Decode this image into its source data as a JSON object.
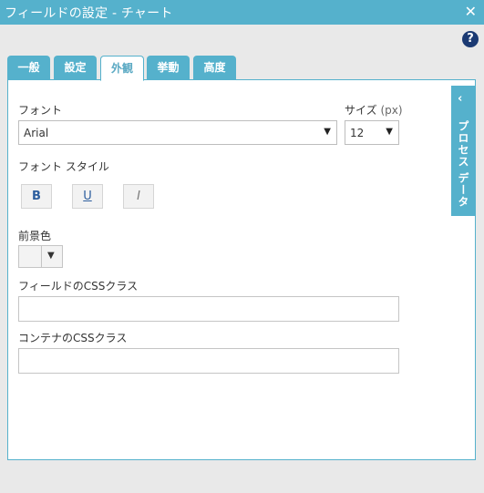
{
  "window": {
    "title": "フィールドの設定 - チャート",
    "close_icon": "close-icon",
    "help": "?"
  },
  "tabs": [
    {
      "label": "一般"
    },
    {
      "label": "設定"
    },
    {
      "label": "外観",
      "active": true
    },
    {
      "label": "挙動"
    },
    {
      "label": "高度"
    }
  ],
  "appearance": {
    "font_label": "フォント",
    "font_value": "Arial",
    "size_label": "サイズ",
    "size_unit": "(px)",
    "size_value": "12",
    "style_label": "フォント スタイル",
    "bold": "B",
    "underline": "U",
    "italic": "I",
    "fg_label": "前景色",
    "field_css_label": "フィールドのCSSクラス",
    "field_css_value": "",
    "container_css_label": "コンテナのCSSクラス",
    "container_css_value": ""
  },
  "side_panel": {
    "label": "プロセス データ",
    "chevron": "‹"
  },
  "colors": {
    "accent": "#55b1cc",
    "help": "#1b3a73"
  }
}
